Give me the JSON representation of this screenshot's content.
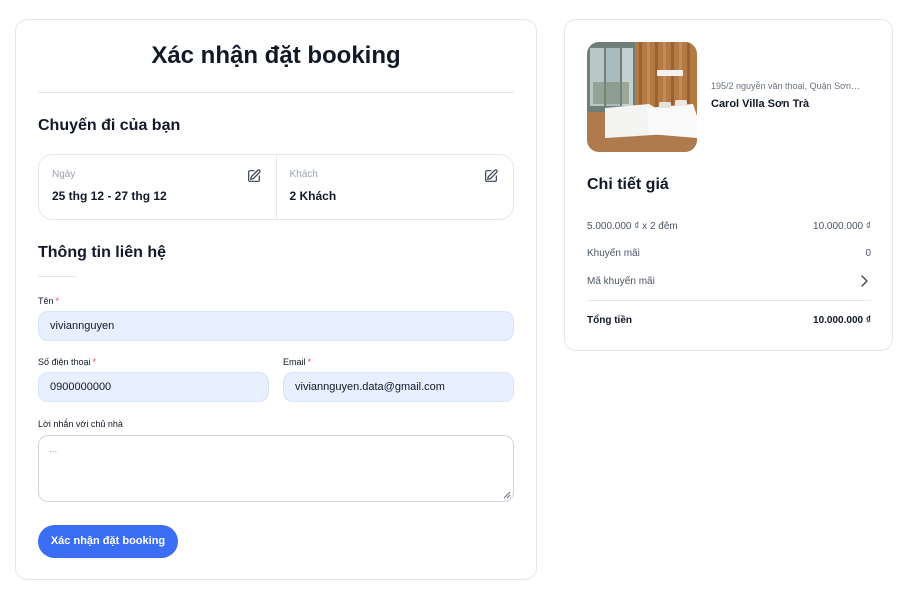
{
  "booking": {
    "title": "Xác nhận đặt booking",
    "trip_section_title": "Chuyến đi của bạn",
    "date_label": "Ngày",
    "date_value": "25 thg 12 - 27 thg 12",
    "guest_label": "Khách",
    "guest_value": "2 Khách",
    "contact_section_title": "Thông tin liên hệ",
    "name_label": "Tên",
    "name_value": "viviannguyen",
    "phone_label": "Số điện thoại",
    "phone_value": "0900000000",
    "email_label": "Email",
    "email_value": "viviannguyen.data@gmail.com",
    "message_label": "Lời nhắn với chủ nhà",
    "message_placeholder": "...",
    "required_mark": "*",
    "submit_label": "Xác nhận đặt booking"
  },
  "summary": {
    "hotel_address": "195/2 nguyễn văn thoại, Quận Sơn…",
    "hotel_name": "Carol Villa Sơn Trà",
    "price_title": "Chi tiết giá",
    "nights_label": "5.000.000 ₫ x 2 đêm",
    "nights_amount": "10.000.000 ₫",
    "discount_label": "Khuyến mãi",
    "discount_amount": "0",
    "promo_label": "Mã khuyến mãi",
    "total_label": "Tổng tiền",
    "total_amount": "10.000.000 ₫"
  },
  "colors": {
    "accent": "#3b6ef5",
    "input_bg": "#e8f0fe",
    "required": "#ef4444"
  }
}
